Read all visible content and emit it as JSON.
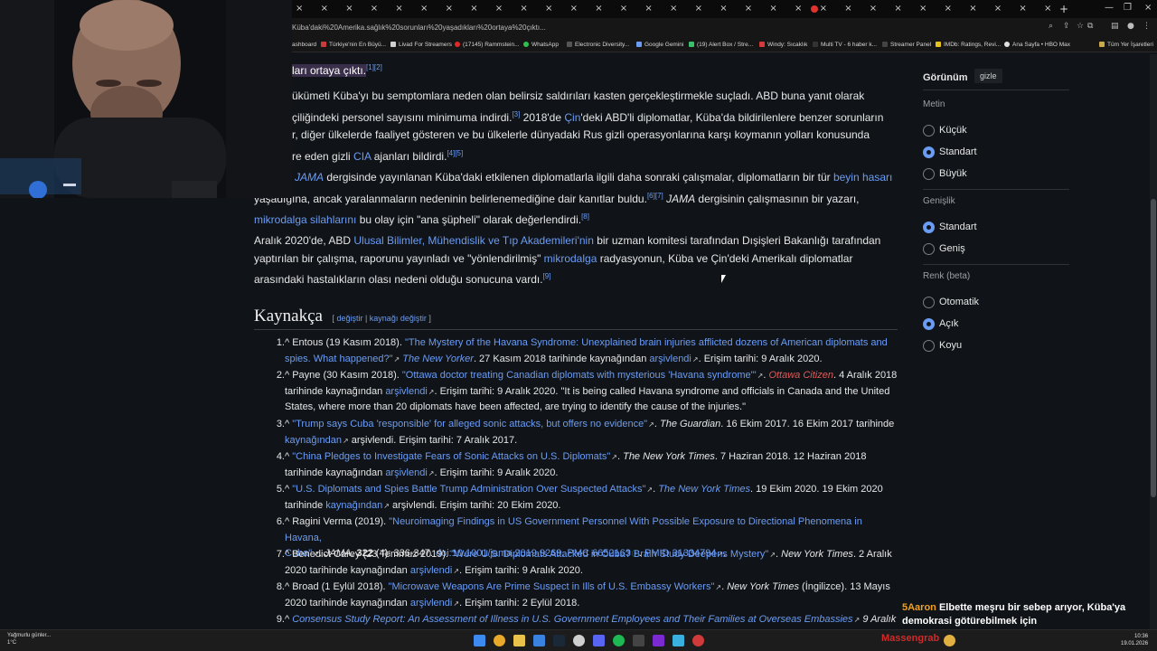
{
  "browser": {
    "url": "Küba'daki%20Amerika.sağlık%20sorunları%20yaşadıkları%20ortaya%20çıktı...",
    "bookmarks": [
      "ashboard",
      "Türkiye'nin En Büyü...",
      "Livad For Streamers",
      "(17145) Rammstein...",
      "WhatsApp",
      "Electronic Diversity...",
      "Google Gemini",
      "(19) Alert Box / Stre...",
      "Windy: Sıcaklık",
      "Multi TV - 6 haber k...",
      "Streamer Panel",
      "IMDb: Ratings, Revi...",
      "Ana Sayfa • HBO Max",
      "Tüm Yer İşaretleri"
    ]
  },
  "article": {
    "p0": {
      "text": "ları ortaya çıktı.",
      "sup": "[1][2]"
    },
    "p1": {
      "l1": "ükümeti Küba'yı bu semptomlara neden olan belirsiz saldırıları kasten gerçekleştirmekle suçladı. ABD buna yanıt olarak",
      "l2a": "çiliğindeki personel sayısını minimuma indirdi.",
      "l2sup": "[3]",
      "l2b": " 2018'de ",
      "l2link": "Çin",
      "l2c": "'deki ABD'li diplomatlar, Küba'da bildirilenlere benzer sorunların",
      "l3": "r, diğer ülkelerde faaliyet gösteren ve bu ülkelerle dünyadaki Rus gizli operasyonlarına karşı koymanın yolları konusunda",
      "l4a": "re eden gizli ",
      "l4link": "CIA",
      "l4b": " ajanları bildirdi.",
      "l4sup": "[4][5]"
    },
    "p2": {
      "l1link": "JAMA",
      "l1a": " dergisinde yayınlanan Küba'daki etkilenen diplomatlarla ilgili daha sonraki çalışmalar, diplomatların bir tür ",
      "l1link2": "beyin hasarı",
      "l2a": "yaşadığına, ancak yaralanmaların nedeninin belirlenemediğine dair kanıtlar buldu.",
      "l2sup": "[6][7]",
      "l2b": " JAMA",
      "l2c": " dergisinin çalışmasının bir yazarı,",
      "l3link": "mikrodalga silahlarını",
      "l3a": " bu olay için \"ana şüpheli\" olarak değerlendirdi.",
      "l3sup": "[8]"
    },
    "p3": {
      "l1a": "Aralık 2020'de, ABD ",
      "l1link": "Ulusal Bilimler, Mühendislik ve Tıp Akademileri'nin",
      "l1b": " bir uzman komitesi tarafından Dışişleri Bakanlığı tarafından",
      "l2a": "yaptırılan bir çalışma, raporunu yayınladı ve \"yönlendirilmiş\" ",
      "l2link": "mikrodalga",
      "l2b": " radyasyonun, Küba ve Çin'deki Amerikalı diplomatlar",
      "l3a": "arasındaki hastalıkların olası nedeni olduğu sonucuna vardı.",
      "l3sup": "[9]"
    },
    "section_title": "Kaynakça",
    "section_edit_open": "[ ",
    "section_edit1": "değiştir",
    "section_edit_sep": " | ",
    "section_edit2": "kaynağı değiştir",
    "section_edit_close": " ]"
  },
  "references": [
    {
      "num": "1.",
      "l1a": "^ Entous (19 Kasım 2018). ",
      "l1link": "\"The Mystery of the Havana Syndrome: Unexplained brain injuries afflicted dozens of American diplomats and",
      "l2link": "spies. What happened?\"",
      "l2pub": "The New Yorker",
      "l2b": ". 27 Kasım 2018 tarihinde kaynağından ",
      "l2arch": "arşivlendi",
      "l2c": ". Erişim tarihi: 9 Aralık 2020."
    },
    {
      "num": "2.",
      "l1a": "^ Payne (30 Kasım 2018). ",
      "l1link": "\"Ottawa doctor treating Canadian diplomats with mysterious 'Havana syndrome'\"",
      "l1pub": "Ottawa Citizen",
      "l1b": ". 4 Aralık 2018",
      "l2a": "tarihinde kaynağından ",
      "l2arch": "arşivlendi",
      "l2b": ". Erişim tarihi: 9 Aralık 2020. \"It is being called Havana syndrome and officials in Canada and the United",
      "l3a": "States, where more than 20 diplomats have been affected, are trying to identify the cause of the injuries.\""
    },
    {
      "num": "3.",
      "l1a": "^ ",
      "l1link": "\"Trump says Cuba 'responsible' for alleged sonic attacks, but offers no evidence\"",
      "l1pub": "The Guardian",
      "l1b": ". 16 Ekim 2017. 16 Ekim 2017 tarihinde",
      "l2arch": "kaynağından",
      "l2b": " arşivlendi. Erişim tarihi: 7 Aralık 2017."
    },
    {
      "num": "4.",
      "l1a": "^ ",
      "l1link": "\"China Pledges to Investigate Fears of Sonic Attacks on U.S. Diplomats\"",
      "l1pub": "The New York Times",
      "l1b": ". 7 Haziran 2018. 12 Haziran 2018",
      "l2a": "tarihinde kaynağından ",
      "l2arch": "arşivlendi",
      "l2b": ". Erişim tarihi: 9 Aralık 2020."
    },
    {
      "num": "5.",
      "l1a": "^ ",
      "l1link": "\"U.S. Diplomats and Spies Battle Trump Administration Over Suspected Attacks\"",
      "l1pub": "The New York Times",
      "l1b": ". 19 Ekim 2020. 19 Ekim 2020",
      "l2a": "tarihinde ",
      "l2arch": "kaynağından",
      "l2b": " arşivlendi. Erişim tarihi: 20 Ekim 2020."
    },
    {
      "num": "6.",
      "l1a": "^ Ragini Verma (2019). ",
      "l1link": "\"Neuroimaging Findings in US Government Personnel With Possible Exposure to Directional Phenomena in Havana,",
      "l2link": "Cuba\"",
      "l2pub": "JAMA",
      "l2vol": "322",
      "l2b": " (4): 336-347. ",
      "l2doi": "doi",
      "l2doival": ":10.1001/jama.2019.9269",
      "l2pmc": "PMC 6652163",
      "l2pmid": "PMID 31334794"
    },
    {
      "num": "7.",
      "l1a": "^ Benedict Carey (23 Temmuz 2019). ",
      "l1link": "\"Were U.S. Diplomats Attacked in Cuba? Brain Study Deepens Mystery\"",
      "l1pub": "New York Times",
      "l1b": ". 2 Aralık",
      "l2a": "2020 tarihinde kaynağından ",
      "l2arch": "arşivlendi",
      "l2b": ". Erişim tarihi: 9 Aralık 2020."
    },
    {
      "num": "8.",
      "l1a": "^ Broad (1 Eylül 2018). ",
      "l1link": "\"Microwave Weapons Are Prime Suspect in Ills of U.S. Embassy Workers\"",
      "l1pub": "New York Times",
      "l1b": " (İngilizce). 13 Mayıs",
      "l2a": "2020 tarihinde kaynağından ",
      "l2arch": "arşivlendi",
      "l2b": ". Erişim tarihi: 2 Eylül 2018."
    },
    {
      "num": "9.",
      "l1a": "^ ",
      "l1link": "Consensus Study Report: An Assessment of Illness in U.S. Government Employees and Their Families at Overseas Embassies",
      "l1b": " 9 Aralık"
    }
  ],
  "sidebar": {
    "title": "Görünüm",
    "hide": "gizle",
    "text_label": "Metin",
    "text_options": [
      "Küçük",
      "Standart",
      "Büyük"
    ],
    "text_selected": "Standart",
    "width_label": "Genişlik",
    "width_options": [
      "Standart",
      "Geniş"
    ],
    "width_selected": "Standart",
    "color_label": "Renk (beta)",
    "color_options": [
      "Otomatik",
      "Açık",
      "Koyu"
    ],
    "color_selected": "Açık"
  },
  "chat": {
    "user": "5Aaron",
    "message": "Elbette meşru bir sebep arıyor, Küba'ya demokrasi götürebilmek için"
  },
  "taskbar": {
    "weather_title": "Yağmurlu günler...",
    "weather_temp": "1°C",
    "brand": "Massengrab",
    "time": "10:36",
    "date": "19.01.2026"
  },
  "colors": {
    "link": "#6b9cf4",
    "background": "#101418",
    "chat_user": "#f0a020",
    "brand": "#d02a2a"
  }
}
